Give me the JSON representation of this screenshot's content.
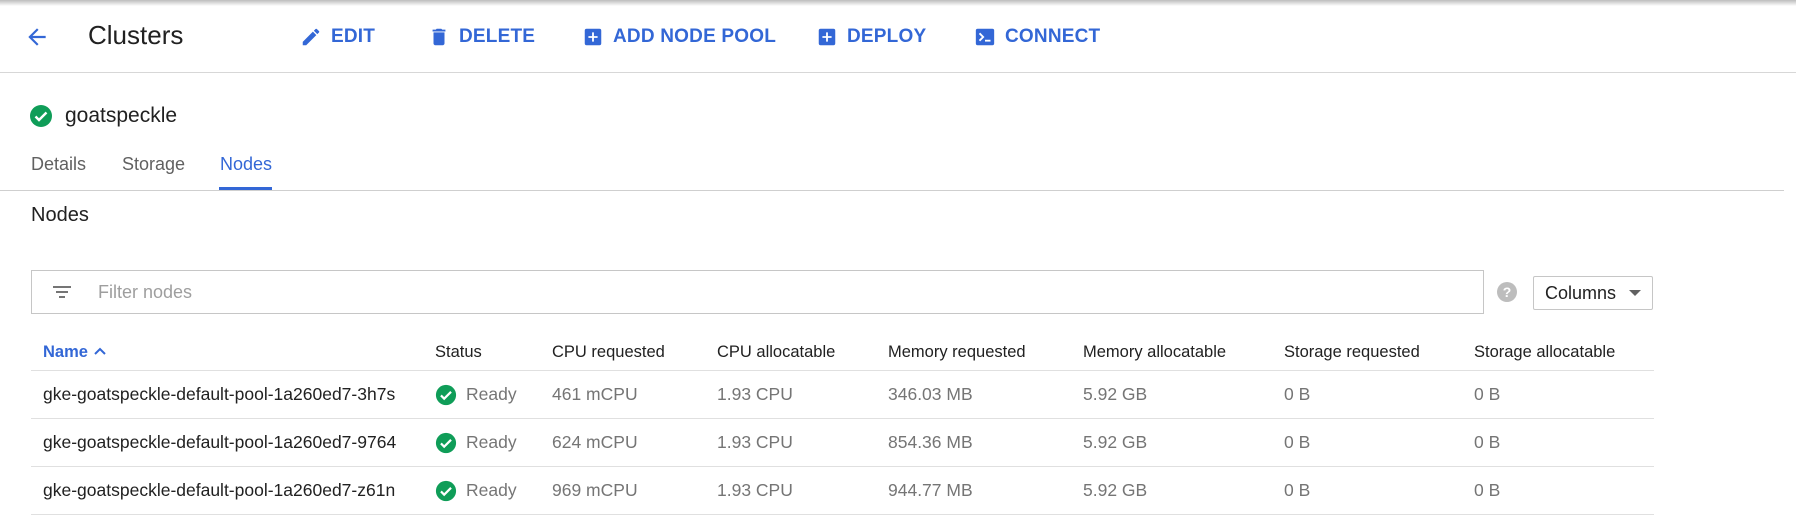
{
  "toolbar": {
    "title": "Clusters",
    "back_icon": "arrow-back-icon",
    "actions": [
      {
        "label": "EDIT",
        "icon": "pencil-icon"
      },
      {
        "label": "DELETE",
        "icon": "trash-icon"
      },
      {
        "label": "ADD NODE POOL",
        "icon": "plus-box-icon"
      },
      {
        "label": "DEPLOY",
        "icon": "plus-box-icon"
      },
      {
        "label": "CONNECT",
        "icon": "terminal-icon"
      }
    ],
    "accent_color": "#3367d6"
  },
  "cluster": {
    "name": "goatspeckle",
    "status_icon": "check-circle-icon",
    "status_color": "#0f9d58"
  },
  "tabs": [
    {
      "label": "Details",
      "active": false
    },
    {
      "label": "Storage",
      "active": false
    },
    {
      "label": "Nodes",
      "active": true
    }
  ],
  "section": {
    "title": "Nodes"
  },
  "filter": {
    "placeholder": "Filter nodes",
    "value": "",
    "icon": "filter-icon"
  },
  "help_icon": "help-circle-icon",
  "columns_button": {
    "label": "Columns",
    "icon": "caret-down-icon"
  },
  "table": {
    "sort_column": "Name",
    "sort_direction": "ascending",
    "headers": [
      "Name",
      "Status",
      "CPU requested",
      "CPU allocatable",
      "Memory requested",
      "Memory allocatable",
      "Storage requested",
      "Storage allocatable"
    ],
    "rows": [
      {
        "name": "gke-goatspeckle-default-pool-1a260ed7-3h7s",
        "status": "Ready",
        "cpu_requested": "461 mCPU",
        "cpu_allocatable": "1.93 CPU",
        "memory_requested": "346.03 MB",
        "memory_allocatable": "5.92 GB",
        "storage_requested": "0 B",
        "storage_allocatable": "0 B"
      },
      {
        "name": "gke-goatspeckle-default-pool-1a260ed7-9764",
        "status": "Ready",
        "cpu_requested": "624 mCPU",
        "cpu_allocatable": "1.93 CPU",
        "memory_requested": "854.36 MB",
        "memory_allocatable": "5.92 GB",
        "storage_requested": "0 B",
        "storage_allocatable": "0 B"
      },
      {
        "name": "gke-goatspeckle-default-pool-1a260ed7-z61n",
        "status": "Ready",
        "cpu_requested": "969 mCPU",
        "cpu_allocatable": "1.93 CPU",
        "memory_requested": "944.77 MB",
        "memory_allocatable": "5.92 GB",
        "storage_requested": "0 B",
        "storage_allocatable": "0 B"
      }
    ]
  }
}
